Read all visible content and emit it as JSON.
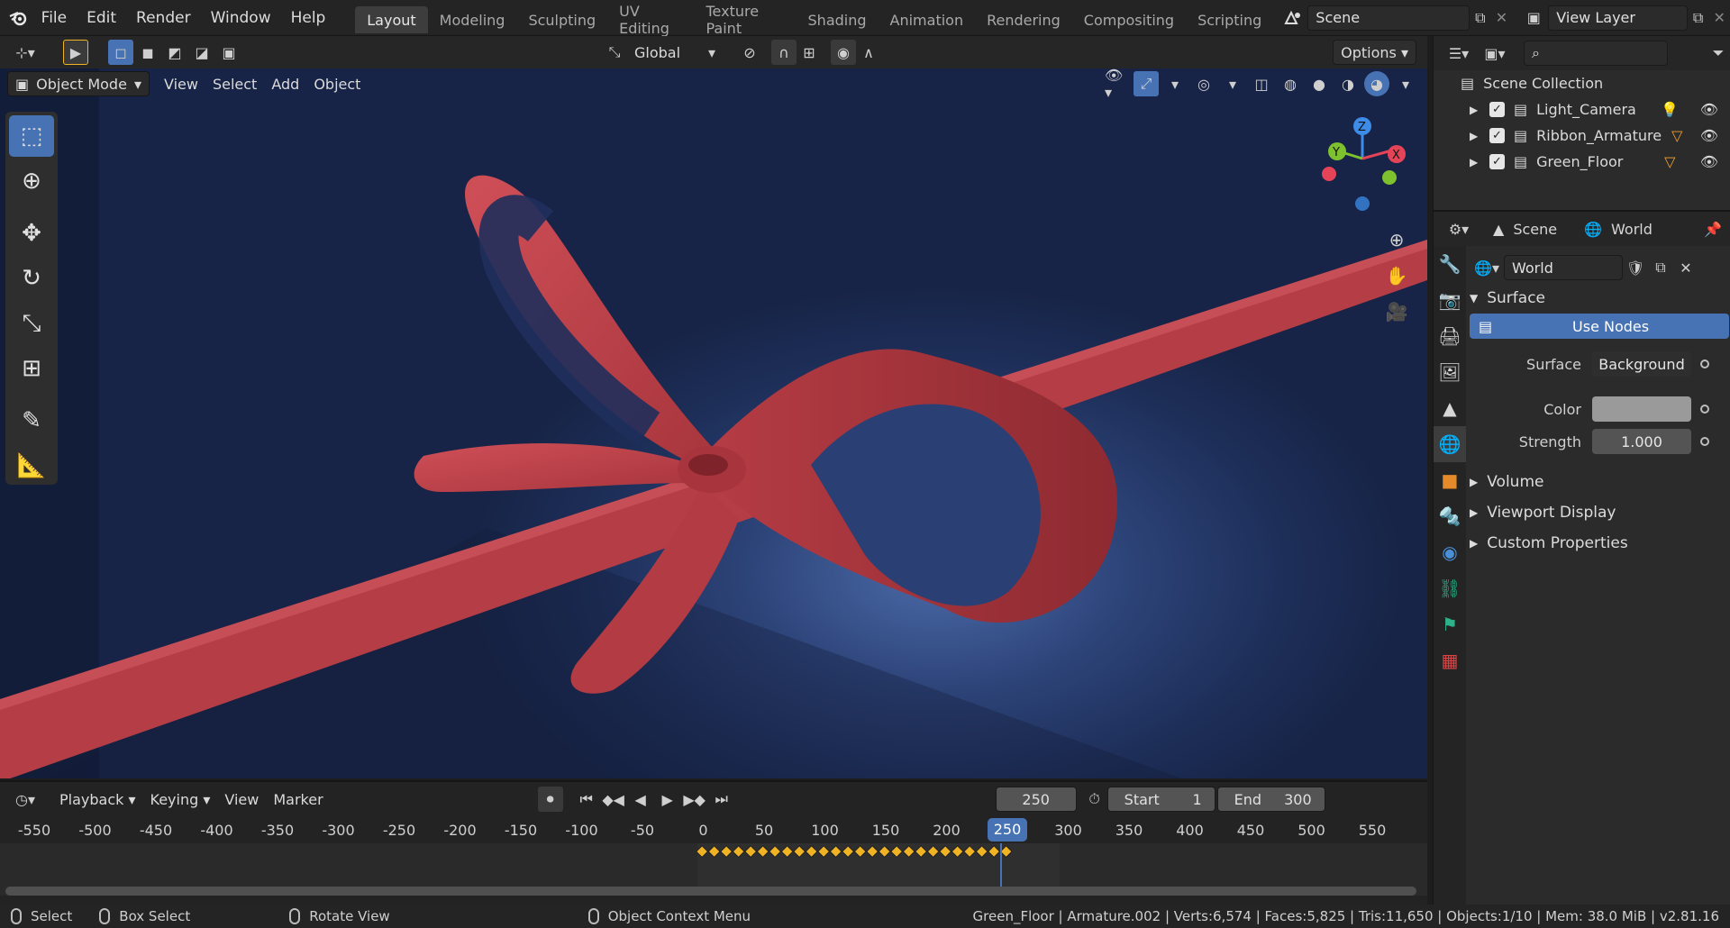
{
  "topbar": {
    "menus": [
      "File",
      "Edit",
      "Render",
      "Window",
      "Help"
    ],
    "workspaces": [
      "Layout",
      "Modeling",
      "Sculpting",
      "UV Editing",
      "Texture Paint",
      "Shading",
      "Animation",
      "Rendering",
      "Compositing",
      "Scripting"
    ],
    "active_workspace": "Layout",
    "scene_name": "Scene",
    "view_layer": "View Layer"
  },
  "tool_header": {
    "orientation": "Global",
    "options_label": "Options"
  },
  "viewport_header": {
    "mode": "Object Mode",
    "menus": [
      "View",
      "Select",
      "Add",
      "Object"
    ]
  },
  "outliner": {
    "root": "Scene Collection",
    "items": [
      {
        "name": "Light_Camera"
      },
      {
        "name": "Ribbon_Armature"
      },
      {
        "name": "Green_Floor"
      }
    ]
  },
  "properties": {
    "breadcrumb_scene": "Scene",
    "breadcrumb_world": "World",
    "world_name": "World",
    "surface_panel": "Surface",
    "use_nodes_label": "Use Nodes",
    "surface_label": "Surface",
    "surface_value": "Background",
    "color_label": "Color",
    "color_value": "#9a9a9a",
    "strength_label": "Strength",
    "strength_value": "1.000",
    "collapsed_panels": [
      "Volume",
      "Viewport Display",
      "Custom Properties"
    ]
  },
  "timeline": {
    "menus": [
      "Playback",
      "Keying",
      "View",
      "Marker"
    ],
    "current_frame": "250",
    "start_label": "Start",
    "start_value": "1",
    "end_label": "End",
    "end_value": "300",
    "ruler_ticks": [
      "-550",
      "-500",
      "-450",
      "-400",
      "-350",
      "-300",
      "-250",
      "-200",
      "-150",
      "-100",
      "-50",
      "0",
      "50",
      "100",
      "150",
      "200",
      "250",
      "300",
      "350",
      "400",
      "450",
      "500",
      "550"
    ]
  },
  "statusbar": {
    "hints": [
      "Select",
      "Box Select",
      "Rotate View",
      "Object Context Menu"
    ],
    "stats": "Green_Floor | Armature.002 | Verts:6,574 | Faces:5,825 | Tris:11,650 | Objects:1/10 | Mem: 38.0 MiB | v2.81.16"
  },
  "colors": {
    "accent": "#4772b3",
    "ribbon": "#c2444c",
    "keyframe": "#f0b323"
  }
}
